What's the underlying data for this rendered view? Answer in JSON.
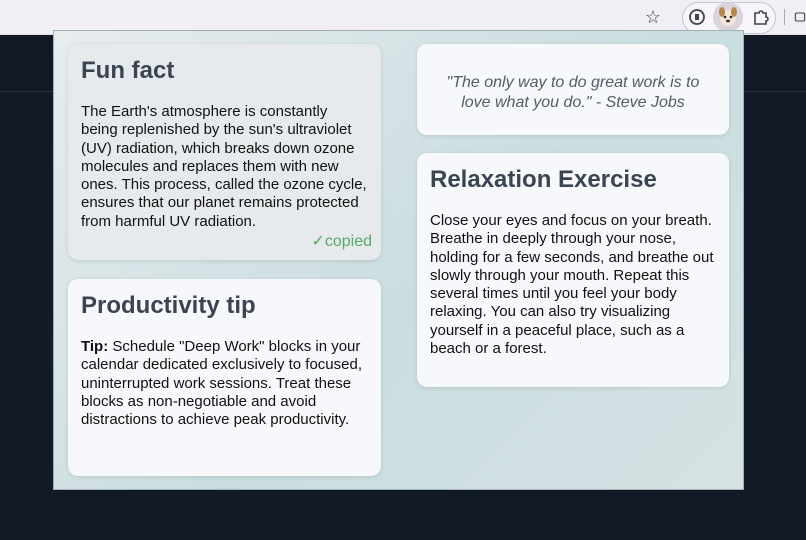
{
  "browser": {
    "icons": [
      "star-icon",
      "password-manager-icon",
      "dog-extension-icon",
      "puzzle-extensions-icon"
    ]
  },
  "fun_fact": {
    "title": "Fun fact",
    "text": "The Earth's atmosphere is constantly being replenished by the sun's ultraviolet (UV) radiation, which breaks down ozone molecules and replaces them with new ones. This process, called the ozone cycle, ensures that our planet remains protected from harmful UV radiation.",
    "status": "✓copied"
  },
  "quote": {
    "text": "\"The only way to do great work is to love what you do.\" - Steve Jobs"
  },
  "productivity": {
    "title": "Productivity tip",
    "tip_label": "Tip:",
    "text": " Schedule \"Deep Work\" blocks in your calendar dedicated exclusively to focused, uninterrupted work sessions. Treat these blocks as non-negotiable and avoid distractions to achieve peak productivity."
  },
  "relaxation": {
    "title": "Relaxation Exercise",
    "text": "Close your eyes and focus on your breath. Breathe in deeply through your nose, holding for a few seconds, and breathe out slowly through your mouth. Repeat this several times until you feel your body relaxing. You can also try visualizing yourself in a peaceful place, such as a beach or a forest."
  },
  "colors": {
    "accent_copied": "#5aa86a",
    "title": "#3b4552",
    "page_background": "#131a27"
  }
}
